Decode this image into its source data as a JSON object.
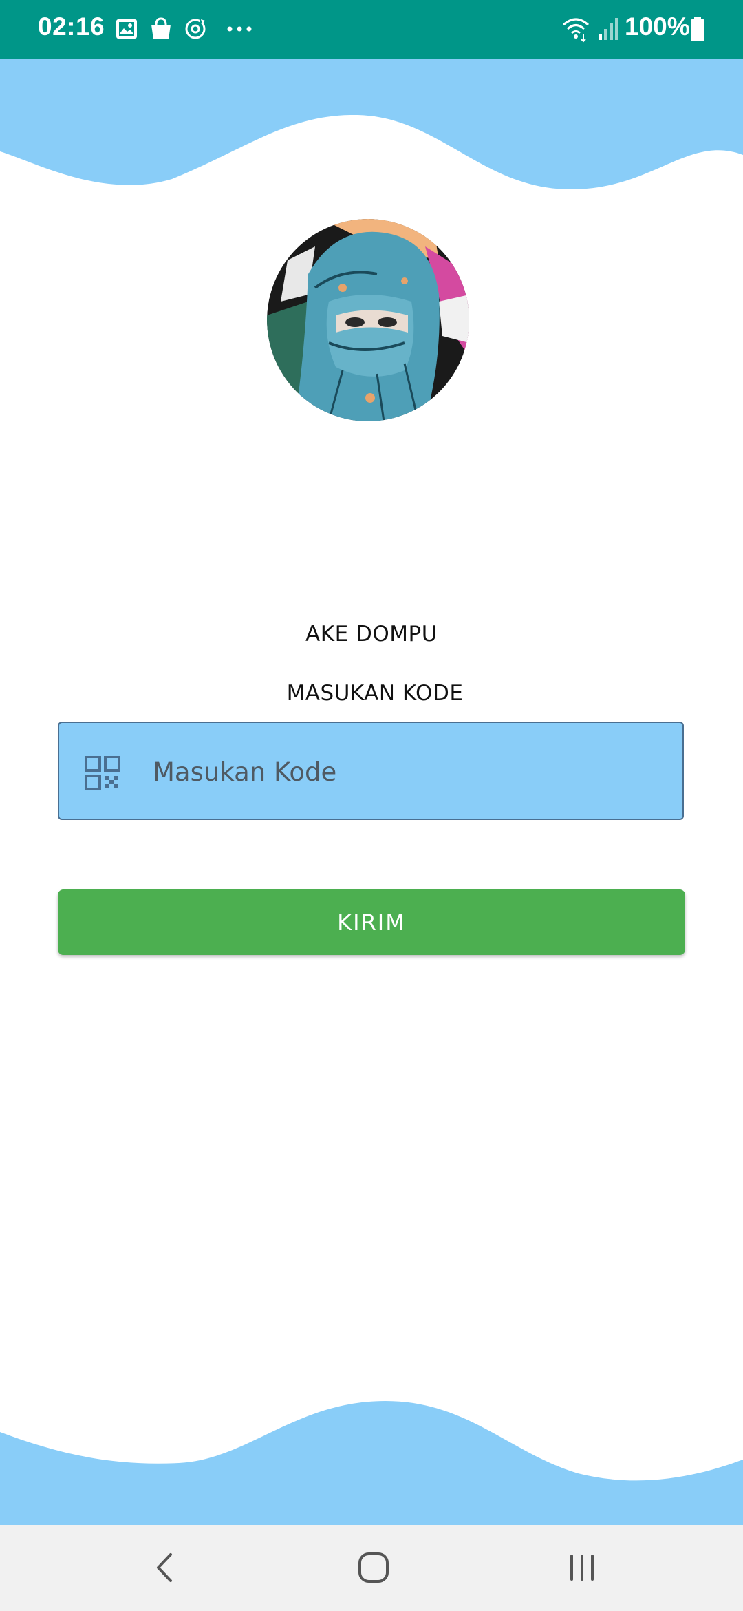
{
  "status_bar": {
    "time": "02:16",
    "battery": "100%",
    "icons": [
      "image-icon",
      "shopping-bag-icon",
      "sync-icon",
      "more-dots-icon",
      "wifi-icon",
      "signal-icon",
      "battery-icon"
    ],
    "color": "#009688"
  },
  "header": {
    "app_name": "AKE DOMPU"
  },
  "form": {
    "label": "MASUKAN KODE",
    "code_input": {
      "placeholder": "Masukan Kode",
      "value": ""
    },
    "submit_label": "KIRIM"
  },
  "colors": {
    "wave": "#89cdf8",
    "field": "#89cdf8",
    "button": "#4caf50",
    "status_bar": "#009688"
  },
  "nav": {
    "icons": [
      "back-icon",
      "home-icon",
      "recents-icon"
    ]
  }
}
